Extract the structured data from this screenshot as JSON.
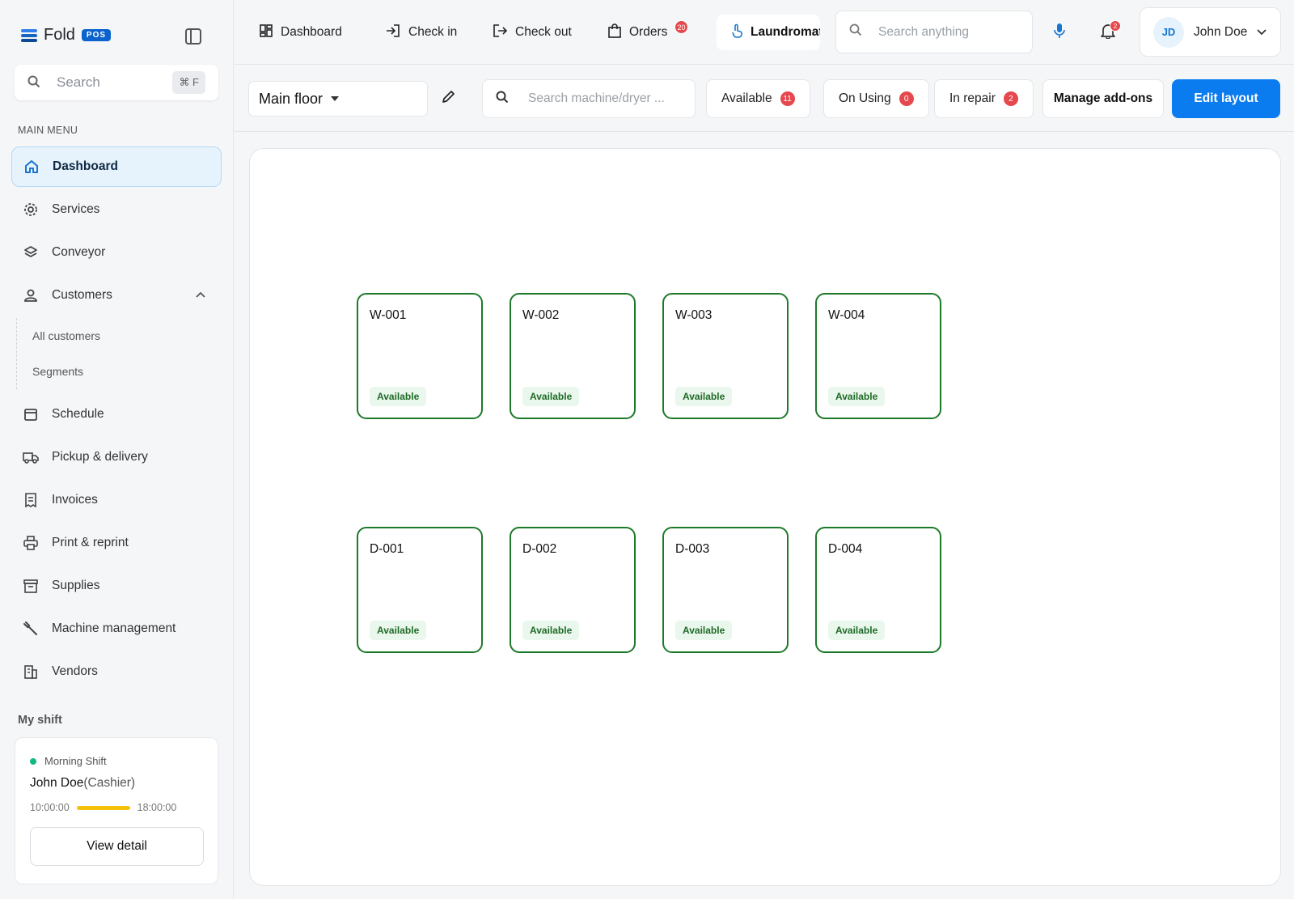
{
  "brand": {
    "name": "Fold",
    "badge": "POS"
  },
  "sidebar": {
    "search_placeholder": "Search",
    "search_shortcut": "⌘ F",
    "menu_title": "MAIN MENU",
    "items": [
      {
        "label": "Dashboard",
        "icon": "home-icon",
        "active": true
      },
      {
        "label": "Services",
        "icon": "gear-icon"
      },
      {
        "label": "Conveyor",
        "icon": "layers-icon"
      },
      {
        "label": "Customers",
        "icon": "user-icon",
        "expanded": true,
        "children": [
          {
            "label": "All customers"
          },
          {
            "label": "Segments"
          }
        ]
      },
      {
        "label": "Schedule",
        "icon": "calendar-icon"
      },
      {
        "label": "Pickup & delivery",
        "icon": "truck-icon"
      },
      {
        "label": "Invoices",
        "icon": "receipt-icon"
      },
      {
        "label": "Print & reprint",
        "icon": "printer-icon"
      },
      {
        "label": "Supplies",
        "icon": "archive-icon"
      },
      {
        "label": "Machine management",
        "icon": "wrench-icon"
      },
      {
        "label": "Vendors",
        "icon": "building-icon"
      }
    ]
  },
  "shift": {
    "title": "My shift",
    "name": "Morning Shift",
    "person": "John Doe",
    "role": "(Cashier)",
    "start": "10:00:00",
    "end": "18:00:00",
    "progress": 1.0,
    "button": "View detail",
    "status_color": "#10b981"
  },
  "topbar": {
    "tabs": [
      {
        "label": "Dashboard",
        "icon": "grid-icon"
      },
      {
        "label": "Check in",
        "icon": "login-icon"
      },
      {
        "label": "Check out",
        "icon": "logout-icon"
      },
      {
        "label": "Orders",
        "icon": "bag-icon",
        "badge": "20"
      }
    ],
    "active_tab": {
      "label": "Laundromat",
      "icon": "touch-icon"
    },
    "search_placeholder": "Search anything",
    "notifications": "2",
    "user": {
      "initials": "JD",
      "name": "John Doe"
    }
  },
  "toolbar": {
    "floor": "Main floor",
    "search_placeholder": "Search machine/dryer ...",
    "filters": [
      {
        "label": "Available",
        "count": "11"
      },
      {
        "label": "On Using",
        "count": "0"
      },
      {
        "label": "In repair",
        "count": "2"
      }
    ],
    "manage_label": "Manage add-ons",
    "edit_label": "Edit layout",
    "accent": "#0b7cf0"
  },
  "machines": [
    {
      "name": "W-001",
      "status": "Available"
    },
    {
      "name": "W-002",
      "status": "Available"
    },
    {
      "name": "W-003",
      "status": "Available"
    },
    {
      "name": "W-004",
      "status": "Available"
    },
    {
      "name": "D-001",
      "status": "Available"
    },
    {
      "name": "D-002",
      "status": "Available"
    },
    {
      "name": "D-003",
      "status": "Available"
    },
    {
      "name": "D-004",
      "status": "Available"
    }
  ]
}
